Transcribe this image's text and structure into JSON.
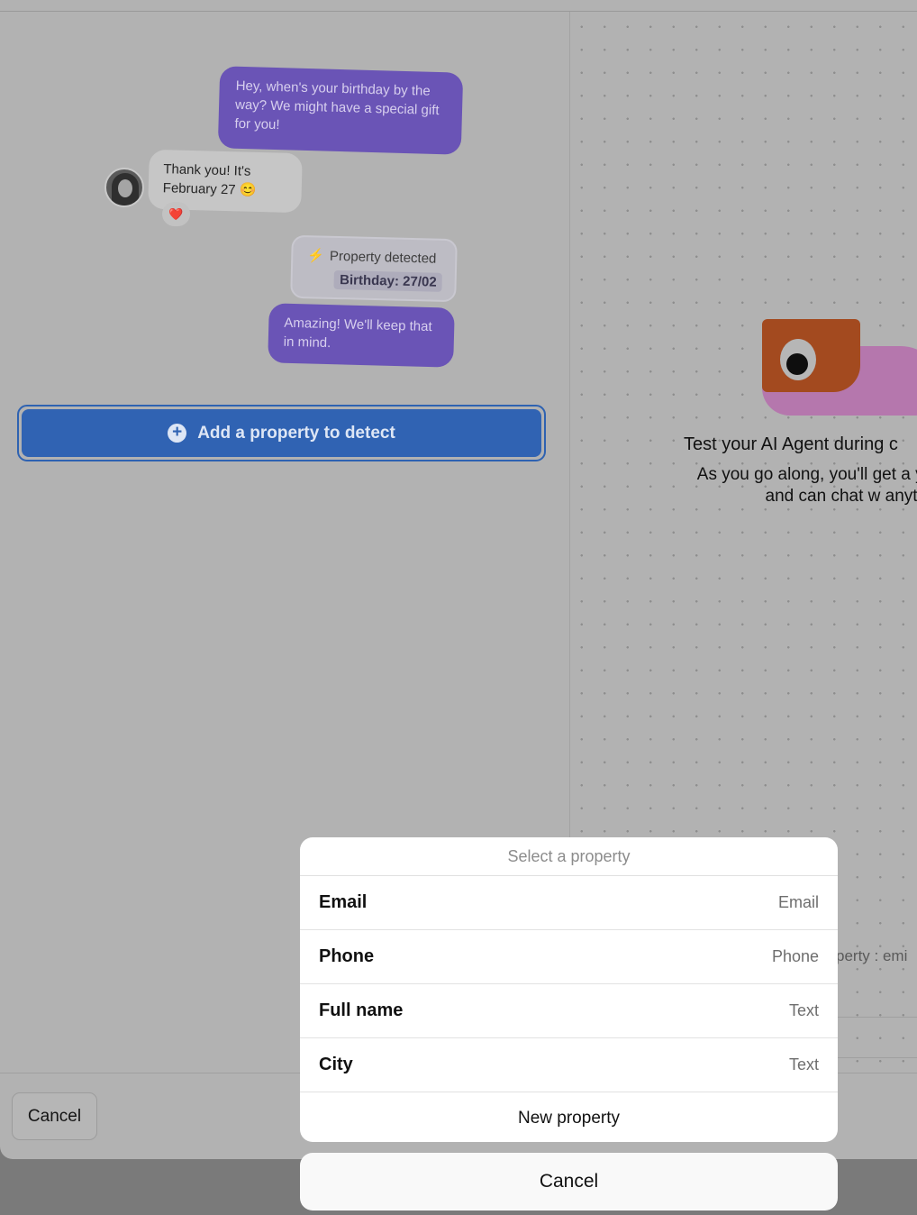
{
  "chat": {
    "agent_message_1": "Hey, when's your birthday by the way? We might have a special gift for you!",
    "user_message": "Thank you! It's February 27 😊",
    "reaction": "❤️",
    "property_detected_label": "Property detected",
    "property_detected_value": "Birthday: 27/02",
    "agent_message_2": "Amazing! We'll keep that in mind."
  },
  "add_property_button": {
    "label": "Add a property to detect",
    "icon": "plus-circle-icon"
  },
  "preview": {
    "title": "Test your AI Agent during c",
    "description": "As you go along, you'll get a your changes and can chat w anytime!",
    "partial_text": "perty : emi"
  },
  "footer": {
    "cancel_label": "Cancel"
  },
  "property_sheet": {
    "title": "Select a property",
    "options": [
      {
        "name": "Email",
        "type": "Email"
      },
      {
        "name": "Phone",
        "type": "Phone"
      },
      {
        "name": "Full name",
        "type": "Text"
      },
      {
        "name": "City",
        "type": "Text"
      }
    ],
    "new_property_label": "New property",
    "cancel_label": "Cancel"
  },
  "colors": {
    "agent_bubble": "#6a54b6",
    "primary_button": "#3063b3",
    "mascot_orange": "#a34a1f",
    "mascot_pink": "#b577ad"
  }
}
